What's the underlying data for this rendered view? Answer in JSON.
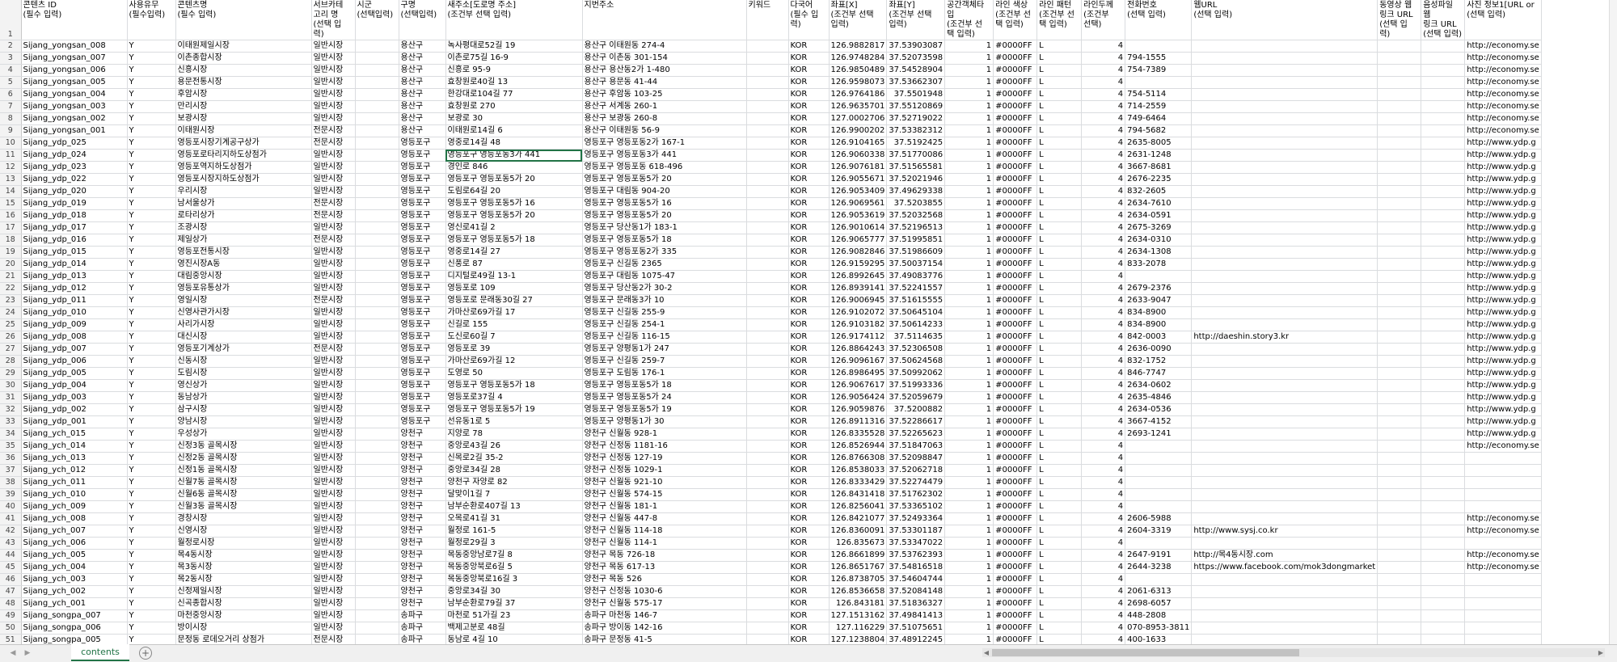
{
  "sheet": {
    "headers": [
      "콘텐츠 ID\n(필수 입력)",
      "사용유무\n(필수입력)",
      "콘텐츠명\n(필수 입력)",
      "서브카테\n고리 명\n(선택 입\n력)",
      "시군\n(선택입력)",
      "구명\n(선택입력)",
      "새주소[도로명 주소]\n(조건부 선택 입력)",
      "지번주소",
      "키워드",
      "다국어\n(필수 입\n력)",
      "좌표[X]\n(조건부 선택\n입력)",
      "좌표[Y]\n(조건부 선택\n입력)",
      "공간객체타\n입\n(조건부 선\n택 입력)",
      "라인 색상\n(조건부 선\n택 입력)",
      "라인 패턴\n(조건부 선\n택 입력)",
      "라인두께\n(조건부\n선택)",
      "전화번호\n(선택 입력)",
      "웹URL\n(선택 입력)",
      "동영상 웹\n링크 URL\n(선택 입\n력)",
      "음성파일 웹\n링크 URL\n(선택 입력)",
      "사진 정보1[URL or\n(선택 입력)"
    ],
    "rows": [
      [
        "Sijang_yongsan_008",
        "Y",
        "이태원제일시장",
        "일반시장",
        "",
        "용산구",
        "녹사평대로52길 19",
        "용산구 이태원동 274-4",
        "",
        "KOR",
        "126.9882817",
        "37.53903087",
        "1",
        "#0000FF",
        "L",
        "4",
        "",
        "",
        "",
        "",
        "http://economy.se"
      ],
      [
        "Sijang_yongsan_007",
        "Y",
        "이촌종합시장",
        "일반시장",
        "",
        "용산구",
        "이촌로75길 16-9",
        "용산구 이촌동 301-154",
        "",
        "KOR",
        "126.9748284",
        "37.52073598",
        "1",
        "#0000FF",
        "L",
        "4",
        "794-1555",
        "",
        "",
        "",
        "http://economy.se"
      ],
      [
        "Sijang_yongsan_006",
        "Y",
        "신흥시장",
        "일반시장",
        "",
        "용산구",
        "신흥로 95-9",
        "용산구 용산동2가 1-480",
        "",
        "KOR",
        "126.9850489",
        "37.54528904",
        "1",
        "#0000FF",
        "L",
        "4",
        "754-7389",
        "",
        "",
        "",
        "http://economy.se"
      ],
      [
        "Sijang_yongsan_005",
        "Y",
        "용문전통시장",
        "일반시장",
        "",
        "용산구",
        "효창원로40길 13",
        "용산구 용문동 41-44",
        "",
        "KOR",
        "126.9598073",
        "37.53662307",
        "1",
        "#0000FF",
        "L",
        "4",
        "",
        "",
        "",
        "",
        "http://economy.se"
      ],
      [
        "Sijang_yongsan_004",
        "Y",
        "후암시장",
        "일반시장",
        "",
        "용산구",
        "한강대로104길 77",
        "용산구 후암동 103-25",
        "",
        "KOR",
        "126.9764186",
        "37.5501948",
        "1",
        "#0000FF",
        "L",
        "4",
        "754-5114",
        "",
        "",
        "",
        "http://economy.se"
      ],
      [
        "Sijang_yongsan_003",
        "Y",
        "만리시장",
        "일반시장",
        "",
        "용산구",
        "효창원로 270",
        "용산구 서계동 260-1",
        "",
        "KOR",
        "126.9635701",
        "37.55120869",
        "1",
        "#0000FF",
        "L",
        "4",
        "714-2559",
        "",
        "",
        "",
        "http://economy.se"
      ],
      [
        "Sijang_yongsan_002",
        "Y",
        "보광시장",
        "일반시장",
        "",
        "용산구",
        "보광로 30",
        "용산구 보광동 260-8",
        "",
        "KOR",
        "127.0002706",
        "37.52719022",
        "1",
        "#0000FF",
        "L",
        "4",
        "749-6464",
        "",
        "",
        "",
        "http://economy.se"
      ],
      [
        "Sijang_yongsan_001",
        "Y",
        "이태원시장",
        "전문시장",
        "",
        "용산구",
        "이태원로14길 6",
        "용산구 이태원동 56-9",
        "",
        "KOR",
        "126.9900202",
        "37.53382312",
        "1",
        "#0000FF",
        "L",
        "4",
        "794-5682",
        "",
        "",
        "",
        "http://economy.se"
      ],
      [
        "Sijang_ydp_025",
        "Y",
        "영등포시장기계공구상가",
        "전문시장",
        "",
        "영등포구",
        "영중로14길 48",
        "영등포구 영등포동2가 167-1",
        "",
        "KOR",
        "126.9104165",
        "37.5192425",
        "1",
        "#0000FF",
        "L",
        "4",
        "2635-8005",
        "",
        "",
        "",
        "http://www.ydp.g"
      ],
      [
        "Sijang_ydp_024",
        "Y",
        "영등포로타리지하도상점가",
        "일반시장",
        "",
        "영등포구",
        "영등포구 영등포동3가 441",
        "영등포구 영등포동3가 441",
        "",
        "KOR",
        "126.9060338",
        "37.51770086",
        "1",
        "#0000FF",
        "L",
        "4",
        "2631-1248",
        "",
        "",
        "",
        "http://www.ydp.g"
      ],
      [
        "Sijang_ydp_023",
        "Y",
        "영등포역지하도상점가",
        "일반시장",
        "",
        "영등포구",
        "경인로 846",
        "영등포구 영등포동 618-496",
        "",
        "KOR",
        "126.9076181",
        "37.51565581",
        "1",
        "#0000FF",
        "L",
        "4",
        "3667-8681",
        "",
        "",
        "",
        "http://www.ydp.g"
      ],
      [
        "Sijang_ydp_022",
        "Y",
        "영등포시장지하도상점가",
        "일반시장",
        "",
        "영등포구",
        "영등포구 영등포동5가 20",
        "영등포구 영등포동5가 20",
        "",
        "KOR",
        "126.9055671",
        "37.52021946",
        "1",
        "#0000FF",
        "L",
        "4",
        "2676-2235",
        "",
        "",
        "",
        "http://www.ydp.g"
      ],
      [
        "Sijang_ydp_020",
        "Y",
        "우리시장",
        "일반시장",
        "",
        "영등포구",
        "도림로64길 20",
        "영등포구 대림동 904-20",
        "",
        "KOR",
        "126.9053409",
        "37.49629338",
        "1",
        "#0000FF",
        "L",
        "4",
        "832-2605",
        "",
        "",
        "",
        "http://www.ydp.g"
      ],
      [
        "Sijang_ydp_019",
        "Y",
        "남서울상가",
        "전문시장",
        "",
        "영등포구",
        "영등포구 영등포동5가 16",
        "영등포구 영등포동5가 16",
        "",
        "KOR",
        "126.9069561",
        "37.5203855",
        "1",
        "#0000FF",
        "L",
        "4",
        "2634-7610",
        "",
        "",
        "",
        "http://www.ydp.g"
      ],
      [
        "Sijang_ydp_018",
        "Y",
        "로타리상가",
        "전문시장",
        "",
        "영등포구",
        "영등포구 영등포동5가 20",
        "영등포구 영등포동5가 20",
        "",
        "KOR",
        "126.9053619",
        "37.52032568",
        "1",
        "#0000FF",
        "L",
        "4",
        "2634-0591",
        "",
        "",
        "",
        "http://www.ydp.g"
      ],
      [
        "Sijang_ydp_017",
        "Y",
        "조광시장",
        "일반시장",
        "",
        "영등포구",
        "영신로41길 2",
        "영등포구 당산동1가 183-1",
        "",
        "KOR",
        "126.9010614",
        "37.52196513",
        "1",
        "#0000FF",
        "L",
        "4",
        "2675-3269",
        "",
        "",
        "",
        "http://www.ydp.g"
      ],
      [
        "Sijang_ydp_016",
        "Y",
        "제일상가",
        "전문시장",
        "",
        "영등포구",
        "영등포구 영등포동5가 18",
        "영등포구 영등포동5가 18",
        "",
        "KOR",
        "126.9065777",
        "37.51995851",
        "1",
        "#0000FF",
        "L",
        "4",
        "2634-0310",
        "",
        "",
        "",
        "http://www.ydp.g"
      ],
      [
        "Sijang_ydp_015",
        "Y",
        "영등포전통시장",
        "일반시장",
        "",
        "영등포구",
        "영중로14길 27",
        "영등포구 영등포동2가 335",
        "",
        "KOR",
        "126.9082846",
        "37.51986609",
        "1",
        "#0000FF",
        "L",
        "4",
        "2634-1308",
        "",
        "",
        "",
        "http://www.ydp.g"
      ],
      [
        "Sijang_ydp_014",
        "Y",
        "영진시장A동",
        "일반시장",
        "",
        "영등포구",
        "신풍로 87",
        "영등포구 신길동 2365",
        "",
        "KOR",
        "126.9159295",
        "37.50037154",
        "1",
        "#0000FF",
        "L",
        "4",
        "833-2078",
        "",
        "",
        "",
        "http://www.ydp.g"
      ],
      [
        "Sijang_ydp_013",
        "Y",
        "대림중앙시장",
        "일반시장",
        "",
        "영등포구",
        "디지털로49길 13-1",
        "영등포구 대림동 1075-47",
        "",
        "KOR",
        "126.8992645",
        "37.49083776",
        "1",
        "#0000FF",
        "L",
        "4",
        "",
        "",
        "",
        "",
        "http://www.ydp.g"
      ],
      [
        "Sijang_ydp_012",
        "Y",
        "영등포유통상가",
        "일반시장",
        "",
        "영등포구",
        "영등포로 109",
        "영등포구 당산동2가 30-2",
        "",
        "KOR",
        "126.8939141",
        "37.52241557",
        "1",
        "#0000FF",
        "L",
        "4",
        "2679-2376",
        "",
        "",
        "",
        "http://www.ydp.g"
      ],
      [
        "Sijang_ydp_011",
        "Y",
        "영일시장",
        "전문시장",
        "",
        "영등포구",
        "영등포로 문래동30길 27",
        "영등포구 문래동3가 10",
        "",
        "KOR",
        "126.9006945",
        "37.51615555",
        "1",
        "#0000FF",
        "L",
        "4",
        "2633-9047",
        "",
        "",
        "",
        "http://www.ydp.g"
      ],
      [
        "Sijang_ydp_010",
        "Y",
        "신영사관가시장",
        "일반시장",
        "",
        "영등포구",
        "가마산로69가길 17",
        "영등포구 신길동 255-9",
        "",
        "KOR",
        "126.9102072",
        "37.50645104",
        "1",
        "#0000FF",
        "L",
        "4",
        "834-8900",
        "",
        "",
        "",
        "http://www.ydp.g"
      ],
      [
        "Sijang_ydp_009",
        "Y",
        "사리가시장",
        "일반시장",
        "",
        "영등포구",
        "신길로 155",
        "영등포구 신길동 254-1",
        "",
        "KOR",
        "126.9103182",
        "37.50614233",
        "1",
        "#0000FF",
        "L",
        "4",
        "834-8900",
        "",
        "",
        "",
        "http://www.ydp.g"
      ],
      [
        "Sijang_ydp_008",
        "Y",
        "대신시장",
        "일반시장",
        "",
        "영등포구",
        "도신로60길 7",
        "영등포구 신길동 116-15",
        "",
        "KOR",
        "126.9174112",
        "37.5114635",
        "1",
        "#0000FF",
        "L",
        "4",
        "842-0003",
        "http://daeshin.story3.kr",
        "",
        "",
        "http://www.ydp.g"
      ],
      [
        "Sijang_ydp_007",
        "Y",
        "영등포기계상가",
        "전문시장",
        "",
        "영등포구",
        "영등포로 39",
        "영등포구 양평동1가 247",
        "",
        "KOR",
        "126.8864243",
        "37.52306508",
        "1",
        "#0000FF",
        "L",
        "4",
        "2636-0090",
        "",
        "",
        "",
        "http://www.ydp.g"
      ],
      [
        "Sijang_ydp_006",
        "Y",
        "신동시장",
        "일반시장",
        "",
        "영등포구",
        "가마산로69가길 12",
        "영등포구 신길동 259-7",
        "",
        "KOR",
        "126.9096167",
        "37.50624568",
        "1",
        "#0000FF",
        "L",
        "4",
        "832-1752",
        "",
        "",
        "",
        "http://www.ydp.g"
      ],
      [
        "Sijang_ydp_005",
        "Y",
        "도림시장",
        "일반시장",
        "",
        "영등포구",
        "도영로 50",
        "영등포구 도림동 176-1",
        "",
        "KOR",
        "126.8986495",
        "37.50992062",
        "1",
        "#0000FF",
        "L",
        "4",
        "846-7747",
        "",
        "",
        "",
        "http://www.ydp.g"
      ],
      [
        "Sijang_ydp_004",
        "Y",
        "영신상가",
        "일반시장",
        "",
        "영등포구",
        "영등포구 영등포동5가 18",
        "영등포구 영등포동5가 18",
        "",
        "KOR",
        "126.9067617",
        "37.51993336",
        "1",
        "#0000FF",
        "L",
        "4",
        "2634-0602",
        "",
        "",
        "",
        "http://www.ydp.g"
      ],
      [
        "Sijang_ydp_003",
        "Y",
        "동남상가",
        "일반시장",
        "",
        "영등포구",
        "영등포로37길 4",
        "영등포구 영등포동5가 24",
        "",
        "KOR",
        "126.9056424",
        "37.52059679",
        "1",
        "#0000FF",
        "L",
        "4",
        "2635-4846",
        "",
        "",
        "",
        "http://www.ydp.g"
      ],
      [
        "Sijang_ydp_002",
        "Y",
        "삼구시장",
        "일반시장",
        "",
        "영등포구",
        "영등포구 영등포동5가 19",
        "영등포구 영등포동5가 19",
        "",
        "KOR",
        "126.9059876",
        "37.5200882",
        "1",
        "#0000FF",
        "L",
        "4",
        "2634-0536",
        "",
        "",
        "",
        "http://www.ydp.g"
      ],
      [
        "Sijang_ydp_001",
        "Y",
        "양남시장",
        "일반시장",
        "",
        "영등포구",
        "선유동1로 5",
        "영등포구 양평동1가 30",
        "",
        "KOR",
        "126.8911316",
        "37.52286617",
        "1",
        "#0000FF",
        "L",
        "4",
        "3667-4152",
        "",
        "",
        "",
        "http://www.ydp.g"
      ],
      [
        "Sijang_ych_015",
        "Y",
        "우성상가",
        "일반시장",
        "",
        "양천구",
        "지양로 78",
        "양천구 신월동 928-1",
        "",
        "KOR",
        "126.8335528",
        "37.52265623",
        "1",
        "#0000FF",
        "L",
        "4",
        "2693-1241",
        "",
        "",
        "",
        "http://www.ydp.g"
      ],
      [
        "Sijang_ych_014",
        "Y",
        "신정3동 골목시장",
        "일반시장",
        "",
        "양천구",
        "중앙로43길 26",
        "양천구 신정동 1181-16",
        "",
        "KOR",
        "126.8526944",
        "37.51847063",
        "1",
        "#0000FF",
        "L",
        "4",
        "",
        "",
        "",
        "",
        "http://economy.se"
      ],
      [
        "Sijang_ych_013",
        "Y",
        "신정2동 골목시장",
        "일반시장",
        "",
        "양천구",
        "신목로2길 35-2",
        "양천구 신정동 127-19",
        "",
        "KOR",
        "126.8766308",
        "37.52098847",
        "1",
        "#0000FF",
        "L",
        "4",
        "",
        "",
        "",
        "",
        ""
      ],
      [
        "Sijang_ych_012",
        "Y",
        "신정1동 골목시장",
        "일반시장",
        "",
        "양천구",
        "중앙로34길 28",
        "양천구 신정동 1029-1",
        "",
        "KOR",
        "126.8538033",
        "37.52062718",
        "1",
        "#0000FF",
        "L",
        "4",
        "",
        "",
        "",
        "",
        ""
      ],
      [
        "Sijang_ych_011",
        "Y",
        "신월7동 골목시장",
        "일반시장",
        "",
        "양천구",
        "양천구 자양로 82",
        "양천구 신월동 921-10",
        "",
        "KOR",
        "126.8333429",
        "37.52274479",
        "1",
        "#0000FF",
        "L",
        "4",
        "",
        "",
        "",
        "",
        ""
      ],
      [
        "Sijang_ych_010",
        "Y",
        "신월6동 골목시장",
        "일반시장",
        "",
        "양천구",
        "달맞이1길 7",
        "양천구 신월동 574-15",
        "",
        "KOR",
        "126.8431418",
        "37.51762302",
        "1",
        "#0000FF",
        "L",
        "4",
        "",
        "",
        "",
        "",
        ""
      ],
      [
        "Sijang_ych_009",
        "Y",
        "신월3동 골목시장",
        "일반시장",
        "",
        "양천구",
        "남부순환로407길 13",
        "양천구 신월동 181-1",
        "",
        "KOR",
        "126.8256041",
        "37.53365102",
        "1",
        "#0000FF",
        "L",
        "4",
        "",
        "",
        "",
        "",
        ""
      ],
      [
        "Sijang_ych_008",
        "Y",
        "경창시장",
        "일반시장",
        "",
        "양천구",
        "오목로41길 31",
        "양천구 신월동 447-8",
        "",
        "KOR",
        "126.8421077",
        "37.52493364",
        "1",
        "#0000FF",
        "L",
        "4",
        "2606-5988",
        "",
        "",
        "",
        "http://economy.se"
      ],
      [
        "Sijang_ych_007",
        "Y",
        "신영시장",
        "일반시장",
        "",
        "양천구",
        "월정로 161-5",
        "양천구 신월동 114-18",
        "",
        "KOR",
        "126.8360091",
        "37.53301187",
        "1",
        "#0000FF",
        "L",
        "4",
        "2604-3319",
        "http://www.sysj.co.kr",
        "",
        "",
        "http://economy.se"
      ],
      [
        "Sijang_ych_006",
        "Y",
        "월정로시장",
        "일반시장",
        "",
        "양천구",
        "월정로29길 3",
        "양천구 신월동 114-1",
        "",
        "KOR",
        "126.835673",
        "37.53347022",
        "1",
        "#0000FF",
        "L",
        "4",
        "",
        "",
        "",
        "",
        ""
      ],
      [
        "Sijang_ych_005",
        "Y",
        "목4동시장",
        "일반시장",
        "",
        "양천구",
        "목동중앙남로7길 8",
        "양천구 목동 726-18",
        "",
        "KOR",
        "126.8661899",
        "37.53762393",
        "1",
        "#0000FF",
        "L",
        "4",
        "2647-9191",
        "http://목4동시장.com",
        "",
        "",
        "http://economy.se"
      ],
      [
        "Sijang_ych_004",
        "Y",
        "목3동시장",
        "일반시장",
        "",
        "양천구",
        "목동중앙북로6길 5",
        "양천구 목동 617-13",
        "",
        "KOR",
        "126.8651767",
        "37.54816518",
        "1",
        "#0000FF",
        "L",
        "4",
        "2644-3238",
        "https://www.facebook.com/mok3dongmarket",
        "",
        "",
        "http://economy.se"
      ],
      [
        "Sijang_ych_003",
        "Y",
        "목2동시장",
        "일반시장",
        "",
        "양천구",
        "목동중앙북로16길 3",
        "양천구 목동 526",
        "",
        "KOR",
        "126.8738705",
        "37.54604744",
        "1",
        "#0000FF",
        "L",
        "4",
        "",
        "",
        "",
        "",
        ""
      ],
      [
        "Sijang_ych_002",
        "Y",
        "신정제일시장",
        "일반시장",
        "",
        "양천구",
        "중앙로34길 30",
        "양천구 신정동 1030-6",
        "",
        "KOR",
        "126.8536658",
        "37.52084148",
        "1",
        "#0000FF",
        "L",
        "4",
        "2061-6313",
        "",
        "",
        "",
        ""
      ],
      [
        "Sijang_ych_001",
        "Y",
        "신곡종합시장",
        "일반시장",
        "",
        "양천구",
        "남부순환로79길 37",
        "양천구 신월동 575-17",
        "",
        "KOR",
        "126.843181",
        "37.51836327",
        "1",
        "#0000FF",
        "L",
        "4",
        "2698-6057",
        "",
        "",
        "",
        ""
      ],
      [
        "Sijang_songpa_007",
        "Y",
        "마천중앙시장",
        "일반시장",
        "",
        "송파구",
        "마천로 51가길 23",
        "송파구 마천동 146-7",
        "",
        "KOR",
        "127.1513162",
        "37.49841413",
        "1",
        "#0000FF",
        "L",
        "4",
        "448-2808",
        "",
        "",
        "",
        ""
      ],
      [
        "Sijang_songpa_006",
        "Y",
        "방이시장",
        "일반시장",
        "",
        "송파구",
        "백제고분로 48길",
        "송파구 방이동 142-16",
        "",
        "KOR",
        "127.116229",
        "37.51075651",
        "1",
        "#0000FF",
        "L",
        "4",
        "070-8953-3811",
        "",
        "",
        "",
        ""
      ],
      [
        "Sijang_songpa_005",
        "Y",
        "문정동 로데오거리 상점가",
        "전문시장",
        "",
        "송파구",
        "동남로 4길 10",
        "송파구 문정동 41-5",
        "",
        "KOR",
        "127.1238804",
        "37.48912245",
        "1",
        "#0000FF",
        "L",
        "4",
        "400-1633",
        "",
        "",
        "",
        ""
      ]
    ]
  },
  "tabs": {
    "active": "contents",
    "add_symbol": "+"
  },
  "nav": {
    "prev": "◀",
    "next": "▶"
  }
}
